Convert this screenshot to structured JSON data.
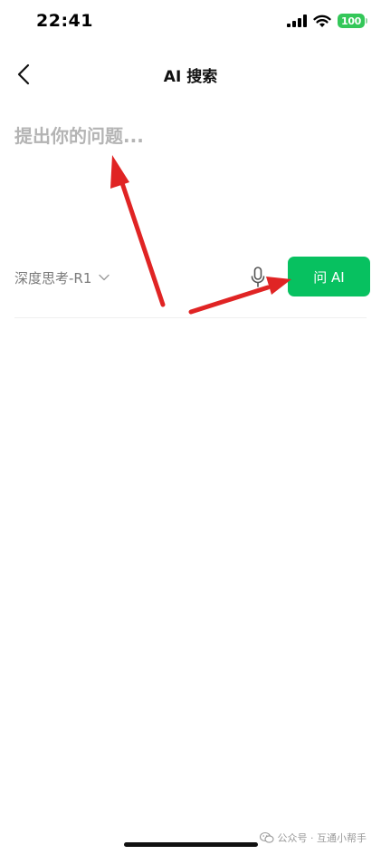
{
  "status_bar": {
    "time": "22:41",
    "battery": "100",
    "icons": [
      "signal-icon",
      "wifi-icon",
      "battery-icon"
    ]
  },
  "nav": {
    "title": "AI 搜索",
    "back_icon": "chevron-left-icon"
  },
  "query": {
    "placeholder": "提出你的问题...",
    "value": ""
  },
  "controls": {
    "model_label": "深度思考-R1",
    "model_icon": "chevron-down-icon",
    "mic_icon": "microphone-icon",
    "ask_label": "问 AI"
  },
  "watermark": {
    "text": "公众号 · 互通小帮手",
    "icon": "wechat-official-account-icon"
  },
  "colors": {
    "accent": "#07c160",
    "annotation_arrow": "#e02424",
    "battery": "#34c759"
  }
}
